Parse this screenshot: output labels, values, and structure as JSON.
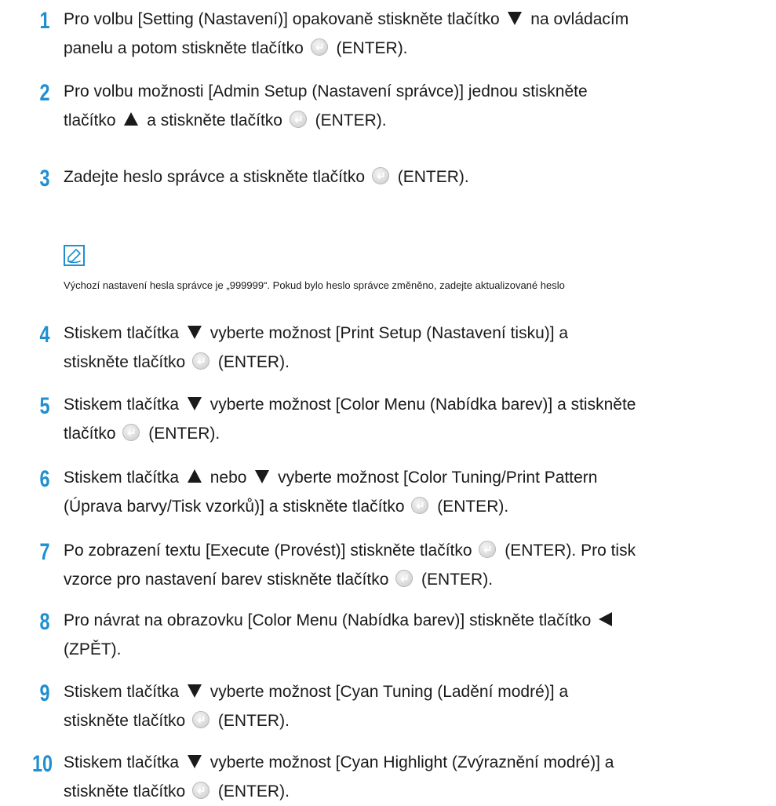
{
  "steps": [
    {
      "num": "1",
      "lines": [
        [
          "Pro volbu [Setting (Nastavení)] opakovaně stiskněte tlačítko ",
          "down",
          " na ovládacím"
        ],
        [
          "panelu a potom stiskněte tlačítko ",
          "enter",
          " (ENTER)."
        ]
      ]
    },
    {
      "num": "2",
      "lines": [
        [
          "Pro volbu možnosti [Admin Setup (Nastavení správce)] jednou stiskněte"
        ],
        [
          "tlačítko ",
          "up",
          " a stiskněte tlačítko ",
          "enter",
          " (ENTER)."
        ]
      ]
    },
    {
      "num": "3",
      "lines": [
        [
          "Zadejte heslo správce a stiskněte tlačítko ",
          "enter",
          " (ENTER)."
        ]
      ]
    },
    {
      "num": "4",
      "lines": [
        [
          "Stiskem tlačítka ",
          "down",
          " vyberte možnost [Print Setup (Nastavení tisku)] a"
        ],
        [
          "stiskněte tlačítko ",
          "enter",
          " (ENTER)."
        ]
      ]
    },
    {
      "num": "5",
      "lines": [
        [
          "Stiskem tlačítka ",
          "down",
          " vyberte možnost [Color Menu (Nabídka barev)] a stiskněte"
        ],
        [
          "tlačítko ",
          "enter",
          " (ENTER)."
        ]
      ]
    },
    {
      "num": "6",
      "lines": [
        [
          "Stiskem tlačítka ",
          "up",
          " nebo ",
          "down",
          " vyberte možnost [Color Tuning/Print Pattern"
        ],
        [
          "(Úprava barvy/Tisk vzorků)] a stiskněte tlačítko ",
          "enter",
          " (ENTER)."
        ]
      ]
    },
    {
      "num": "7",
      "lines": [
        [
          "Po zobrazení textu [Execute (Provést)] stiskněte tlačítko ",
          "enter",
          " (ENTER). Pro tisk"
        ],
        [
          "vzorce pro nastavení barev stiskněte tlačítko ",
          "enter",
          " (ENTER)."
        ]
      ]
    },
    {
      "num": "8",
      "lines": [
        [
          "Pro návrat na obrazovku [Color Menu (Nabídka barev)] stiskněte tlačítko ",
          "left"
        ],
        [
          "(ZPĚT)."
        ]
      ]
    },
    {
      "num": "9",
      "lines": [
        [
          "Stiskem tlačítka ",
          "down",
          " vyberte možnost [Cyan Tuning (Ladění modré)] a"
        ],
        [
          "stiskněte tlačítko ",
          "enter",
          " (ENTER)."
        ]
      ]
    },
    {
      "num": "10",
      "lines": [
        [
          "Stiskem tlačítka ",
          "down",
          " vyberte možnost [Cyan Highlight (Zvýraznění modré)] a"
        ],
        [
          "stiskněte tlačítko ",
          "enter",
          " (ENTER)."
        ]
      ]
    }
  ],
  "note": {
    "icon": "memo-pen-icon",
    "text": "Výchozí nastavení hesla správce je „999999“. Pokud bylo heslo správce změněno, zadejte aktualizované heslo"
  },
  "icons": {
    "down": "triangle-down-icon",
    "up": "triangle-up-icon",
    "left": "triangle-left-icon",
    "enter": "enter-button-icon"
  },
  "colors": {
    "step_number": "#1f8fd0",
    "note_border": "#1f8fd0",
    "text": "#1a1a1a"
  }
}
